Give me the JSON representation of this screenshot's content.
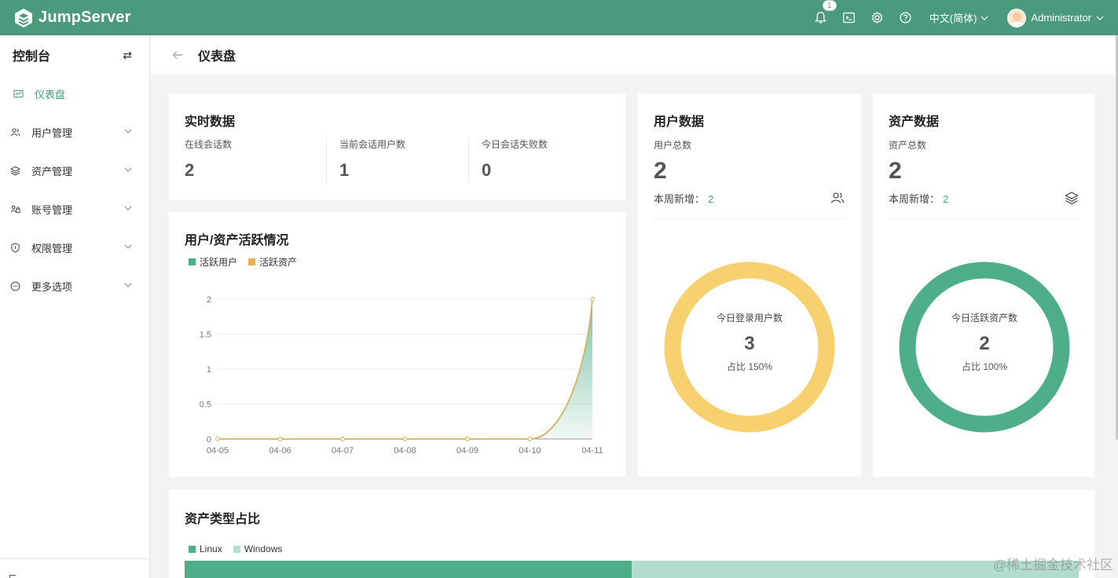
{
  "app": {
    "brand": "JumpServer"
  },
  "header": {
    "notification_count": "1",
    "language": "中文(简体)",
    "user_name": "Administrator"
  },
  "sidebar": {
    "title": "控制台",
    "items": [
      {
        "label": "仪表盘",
        "icon": "dashboard-icon",
        "active": true
      },
      {
        "label": "用户管理",
        "icon": "users-icon"
      },
      {
        "label": "资产管理",
        "icon": "layers-icon"
      },
      {
        "label": "账号管理",
        "icon": "account-icon"
      },
      {
        "label": "权限管理",
        "icon": "shield-icon"
      },
      {
        "label": "更多选项",
        "icon": "more-icon"
      }
    ]
  },
  "page": {
    "title": "仪表盘"
  },
  "realtime": {
    "title": "实时数据",
    "stats": [
      {
        "label": "在线会话数",
        "value": "2"
      },
      {
        "label": "当前会话用户数",
        "value": "1"
      },
      {
        "label": "今日会话失败数",
        "value": "0"
      }
    ]
  },
  "user_data": {
    "title": "用户数据",
    "total_label": "用户总数",
    "total": "2",
    "week_label": "本周新增：",
    "week_value": "2",
    "donut_label": "今日登录用户数",
    "donut_value": "3",
    "donut_pct": "占比 150%"
  },
  "asset_data": {
    "title": "资产数据",
    "total_label": "资产总数",
    "total": "2",
    "week_label": "本周新增：",
    "week_value": "2",
    "donut_label": "今日活跃资产数",
    "donut_value": "2",
    "donut_pct": "占比 100%"
  },
  "colors": {
    "primary": "#4a9b7e",
    "active_user": "#4fae8a",
    "active_asset": "#e3b15c",
    "donut_yellow": "#f7d06f",
    "donut_green": "#4fae8a",
    "windows": "#b2ddcc"
  },
  "chart_data": {
    "type": "line",
    "title": "用户/资产活跃情况",
    "categories": [
      "04-05",
      "04-06",
      "04-07",
      "04-08",
      "04-09",
      "04-10",
      "04-11"
    ],
    "series": [
      {
        "name": "活跃用户",
        "values": [
          0,
          0,
          0,
          0,
          0,
          0,
          2
        ]
      },
      {
        "name": "活跃资产",
        "values": [
          0,
          0,
          0,
          0,
          0,
          0,
          2
        ]
      }
    ],
    "yticks": [
      "0",
      "0.5",
      "1",
      "1.5",
      "2"
    ],
    "ylim": [
      0,
      2
    ],
    "grid": true,
    "legend": "top-left"
  },
  "asset_types": {
    "title": "资产类型占比",
    "legend": [
      {
        "name": "Linux",
        "share": 0.5
      },
      {
        "name": "Windows",
        "share": 0.5
      }
    ]
  },
  "watermark": "@稀土掘金技术社区"
}
